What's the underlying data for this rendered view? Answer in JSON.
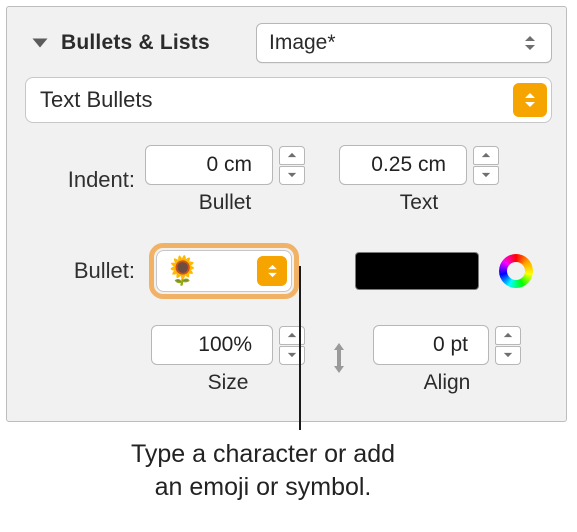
{
  "section": {
    "title": "Bullets & Lists"
  },
  "list_style_popup": {
    "value": "Image*"
  },
  "bullet_type_popup": {
    "value": "Text Bullets"
  },
  "indent": {
    "label": "Indent:",
    "bullet": {
      "value": "0 cm",
      "sublabel": "Bullet"
    },
    "text": {
      "value": "0.25 cm",
      "sublabel": "Text"
    }
  },
  "bullet": {
    "label": "Bullet:",
    "glyph": "🌻",
    "color_hex": "#000000"
  },
  "size": {
    "value": "100%",
    "sublabel": "Size"
  },
  "align": {
    "value": "0 pt",
    "sublabel": "Align"
  },
  "caption": {
    "line1": "Type a character or add",
    "line2": "an emoji or symbol."
  }
}
